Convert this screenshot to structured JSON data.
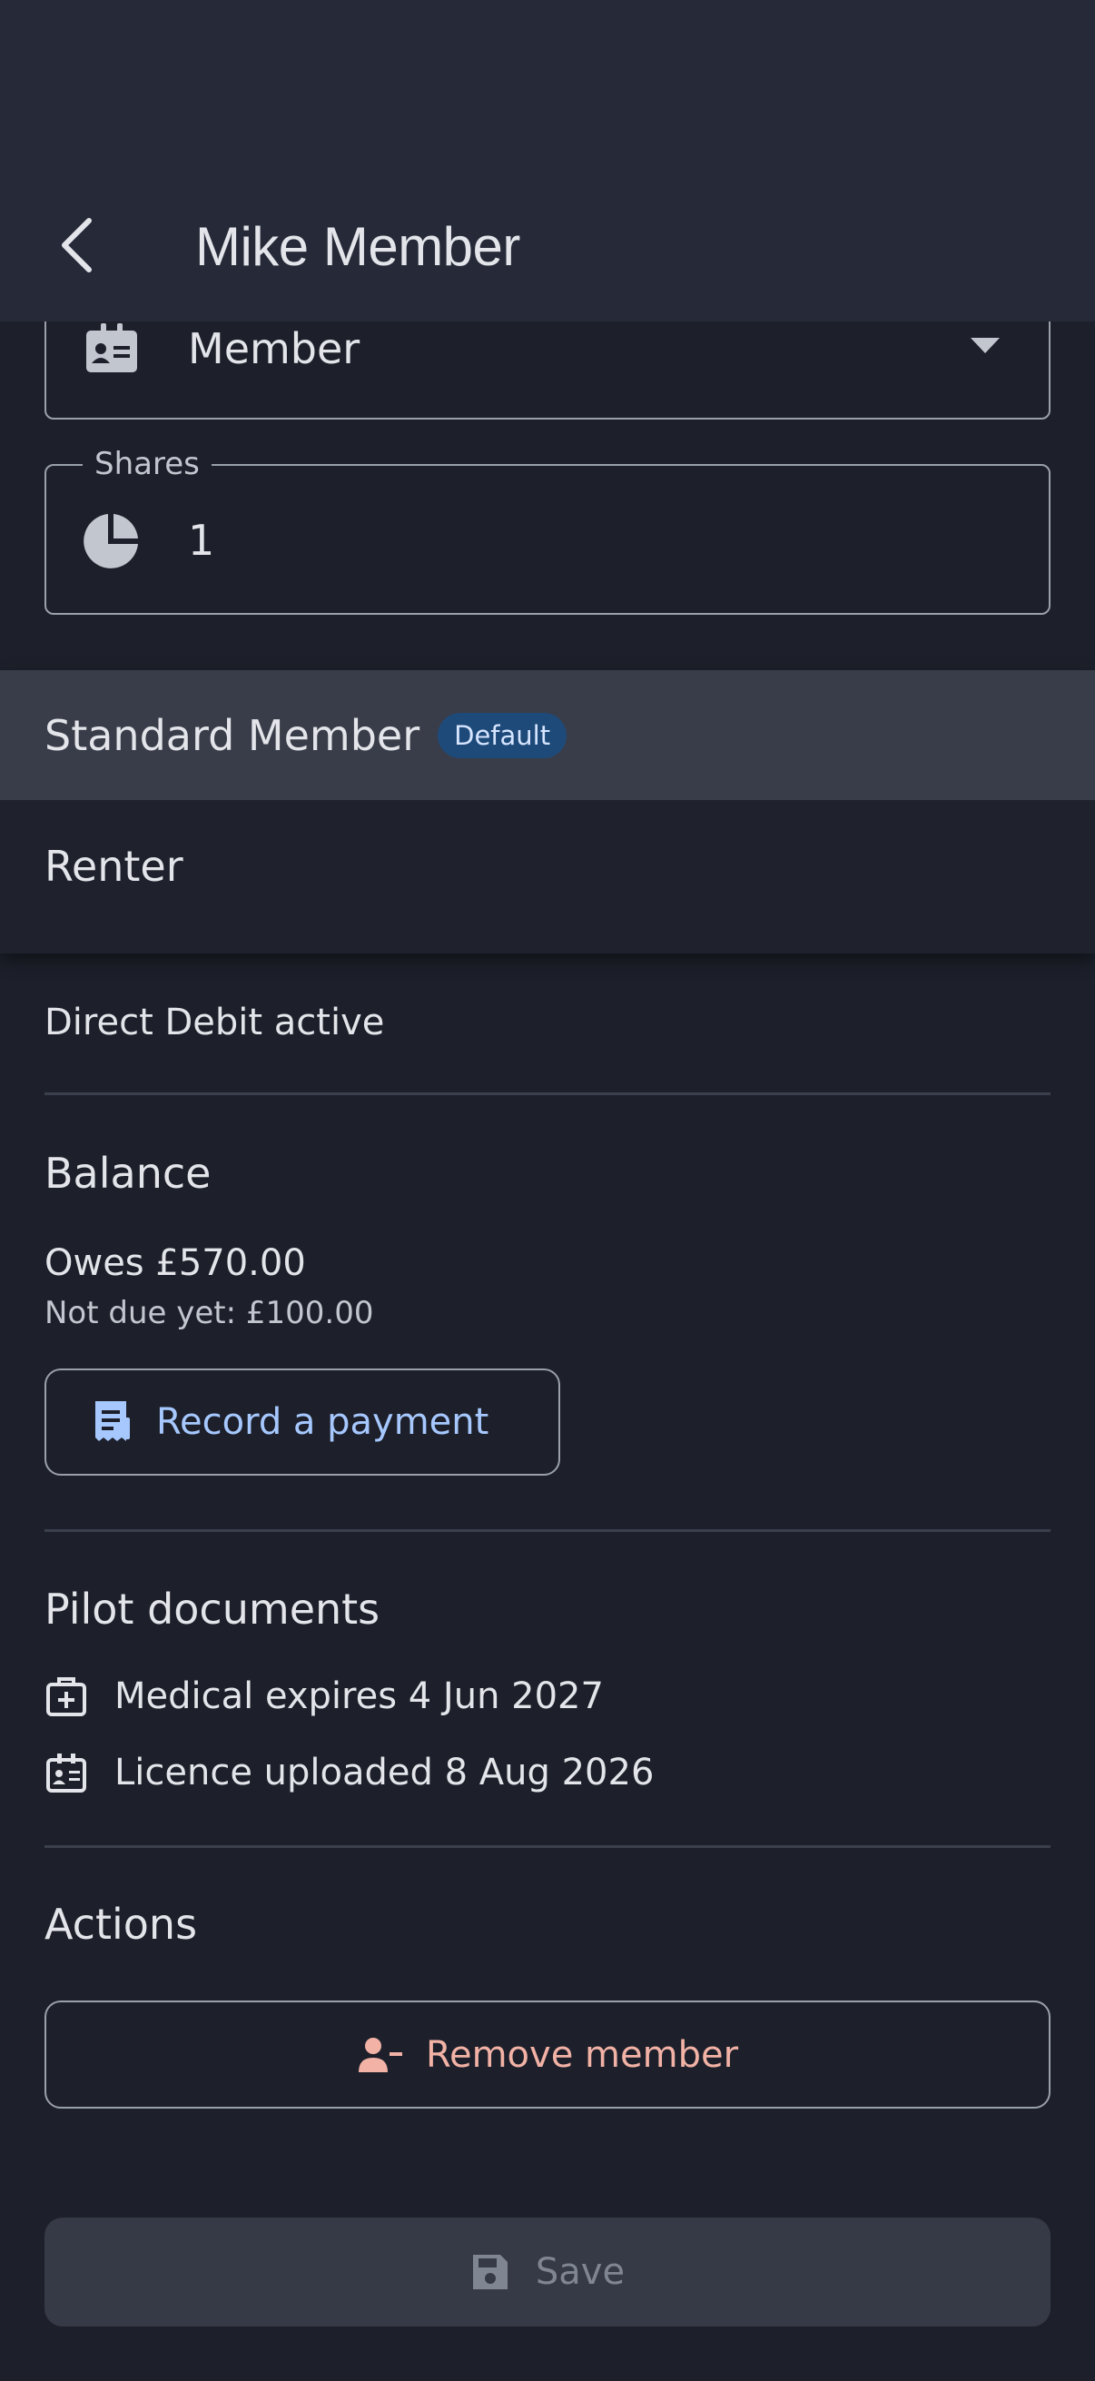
{
  "header": {
    "title": "Mike Member",
    "back_icon": "chevron-left-icon"
  },
  "type_field": {
    "value": "Member",
    "icon": "badge-id-icon"
  },
  "shares_field": {
    "label": "Shares",
    "value": "1",
    "icon": "pie-chart-icon"
  },
  "menu": {
    "items": [
      {
        "label": "Standard Member",
        "badge": "Default",
        "selected": true
      },
      {
        "label": "Renter"
      }
    ]
  },
  "payment": {
    "status": "Direct Debit active"
  },
  "balance": {
    "heading": "Balance",
    "owes": "Owes £570.00",
    "not_due": "Not due yet: £100.00",
    "record_label": "Record a payment",
    "record_icon": "receipt-icon"
  },
  "pilot_documents": {
    "heading": "Pilot documents",
    "medical": "Medical expires 4 Jun 2027",
    "licence": "Licence uploaded 8 Aug 2026"
  },
  "actions": {
    "heading": "Actions",
    "remove_label": "Remove member",
    "remove_icon": "person-remove-icon"
  },
  "save": {
    "label": "Save",
    "icon": "floppy-disk-icon",
    "disabled": true
  },
  "colors": {
    "background": "#1d202a",
    "appbar": "#262a38",
    "accent_blue": "#a6c8ff",
    "danger": "#f2b2a6",
    "badge": "#1e4a7a"
  }
}
